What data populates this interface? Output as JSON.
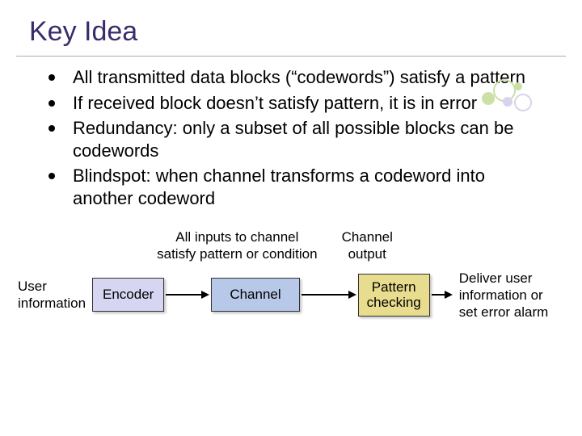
{
  "title": "Key Idea",
  "bullets": [
    "All transmitted data blocks (“codewords”) satisfy a pattern",
    "If received block doesn’t satisfy pattern, it is in error",
    "Redundancy: only a subset of all possible blocks can be codewords",
    "Blindspot:  when channel transforms a codeword into another codeword"
  ],
  "mid_labels": {
    "inputs": "All inputs to channel\nsatisfy pattern or condition",
    "output": "Channel\noutput"
  },
  "flow": {
    "user_info": "User\ninformation",
    "encoder": "Encoder",
    "channel": "Channel",
    "pattern": "Pattern\nchecking",
    "deliver": "Deliver user\ninformation or\nset error alarm"
  }
}
